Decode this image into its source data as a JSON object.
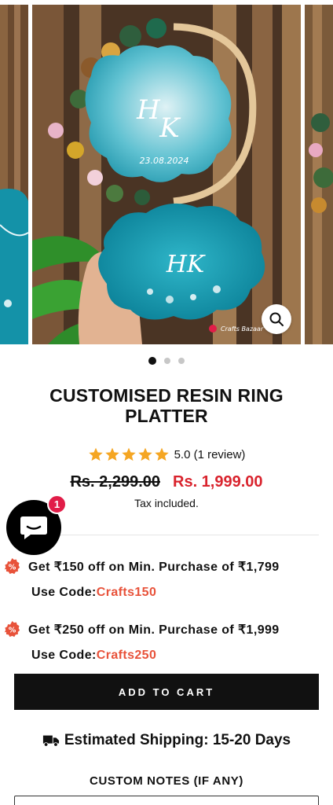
{
  "gallery": {
    "slide_count": 3,
    "active_index": 0,
    "image_alt": "Customised resin ring platter photo",
    "platter_top_initials": "HK",
    "platter_top_date": "23.08.2024",
    "platter_bottom_initials": "HK",
    "watermark": "Crafts Bazaar",
    "zoom_icon": "magnifier-icon"
  },
  "product": {
    "title": "CUSTOMISED RESIN RING PLATTER",
    "rating_value": 5.0,
    "rating_text": "5.0 (1 review)",
    "compare_price": "Rs. 2,299.00",
    "price": "Rs. 1,999.00",
    "tax_note": "Tax included."
  },
  "chat": {
    "badge_count": "1",
    "icon": "chat-bubble-icon"
  },
  "offers": [
    {
      "text": "Get ₹150 off on Min. Purchase of ₹1,799",
      "code_label": "Use Code:",
      "code": "Crafts150"
    },
    {
      "text": "Get ₹250 off on Min. Purchase of ₹1,999",
      "code_label": "Use Code:",
      "code": "Crafts250"
    }
  ],
  "actions": {
    "add_to_cart": "ADD TO CART"
  },
  "shipping": {
    "icon": "truck-icon",
    "text": "Estimated Shipping: 15-20 Days"
  },
  "notes": {
    "label": "CUSTOM NOTES (IF ANY)",
    "value": ""
  },
  "colors": {
    "accent_red": "#d9232d",
    "code_orange": "#e8523a",
    "offer_badge": "#e8523a",
    "star": "#f5a623",
    "button_bg": "#111111",
    "resin_teal": "#1f9fb4"
  }
}
